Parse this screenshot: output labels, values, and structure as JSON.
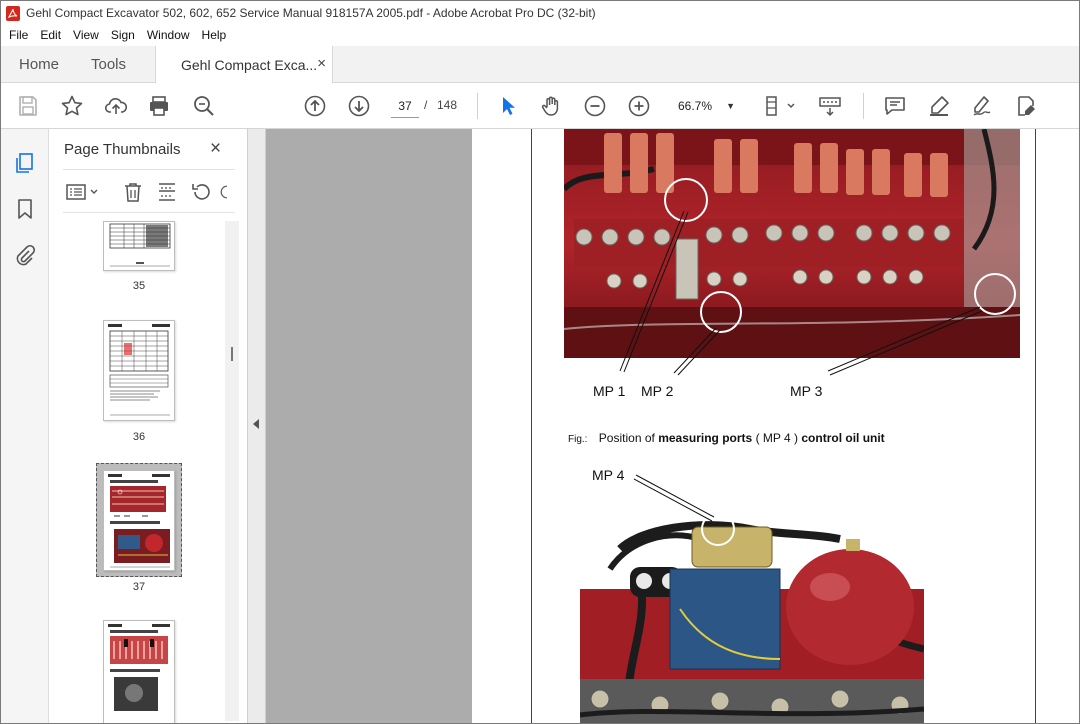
{
  "window": {
    "title": "Gehl Compact Excavator 502, 602, 652 Service Manual 918157A 2005.pdf - Adobe Acrobat Pro DC (32-bit)"
  },
  "menu": [
    "File",
    "Edit",
    "View",
    "Sign",
    "Window",
    "Help"
  ],
  "tabs": {
    "home": "Home",
    "tools": "Tools",
    "document": "Gehl Compact Exca...",
    "close": "×"
  },
  "toolbar": {
    "current_page": "37",
    "page_separator": "/",
    "total_pages": "148",
    "zoom": "66.7%"
  },
  "thumbnails": {
    "title": "Page Thumbnails",
    "close": "×",
    "pages": [
      {
        "label": "35"
      },
      {
        "label": "36"
      },
      {
        "label": "37",
        "selected": true
      },
      {
        "label": ""
      }
    ]
  },
  "document": {
    "callouts": {
      "mp1": "MP 1",
      "mp2": "MP 2",
      "mp3": "MP 3",
      "mp4": "MP 4"
    },
    "caption": {
      "fig": "Fig.:",
      "part1": "Position of",
      "part2": "measuring ports",
      "part3": "( MP 4 )",
      "part4": "control oil unit"
    }
  },
  "colors": {
    "acrobat_red": "#d4281c",
    "accent_blue": "#1473e6",
    "valve_red": "#b5242a"
  }
}
